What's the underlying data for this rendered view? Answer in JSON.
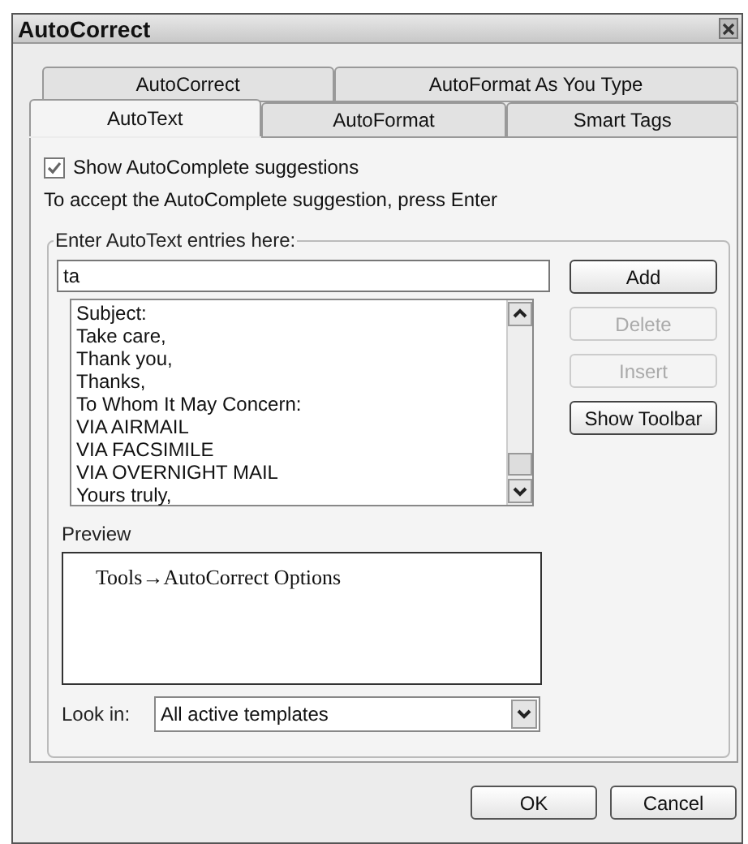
{
  "window": {
    "title": "AutoCorrect"
  },
  "tab_rows": [
    {
      "tabs": [
        {
          "label": "AutoCorrect",
          "selected": false
        },
        {
          "label": "AutoFormat As You Type",
          "selected": false
        }
      ]
    },
    {
      "tabs": [
        {
          "label": "AutoText",
          "selected": true
        },
        {
          "label": "AutoFormat",
          "selected": false
        },
        {
          "label": "Smart Tags",
          "selected": false
        }
      ]
    }
  ],
  "show_autocomplete": {
    "label": "Show AutoComplete suggestions",
    "checked": true
  },
  "hint": "To accept the AutoComplete suggestion, press Enter",
  "entries_group": {
    "label": "Enter AutoText entries here:",
    "value": "ta",
    "items": [
      "Subject:",
      "Take care,",
      "Thank you,",
      "Thanks,",
      "To Whom It May Concern:",
      "VIA AIRMAIL",
      "VIA FACSIMILE",
      "VIA OVERNIGHT MAIL",
      "Yours truly,"
    ],
    "buttons": [
      {
        "label": "Add",
        "disabled": false
      },
      {
        "label": "Delete",
        "disabled": true
      },
      {
        "label": "Insert",
        "disabled": true
      },
      {
        "label": "Show Toolbar",
        "disabled": false
      }
    ],
    "preview_label": "Preview",
    "preview_text": "Tools→AutoCorrect Options",
    "look_in_label": "Look in:",
    "look_in_value": "All active templates"
  },
  "buttons": [
    "OK",
    "Cancel"
  ]
}
